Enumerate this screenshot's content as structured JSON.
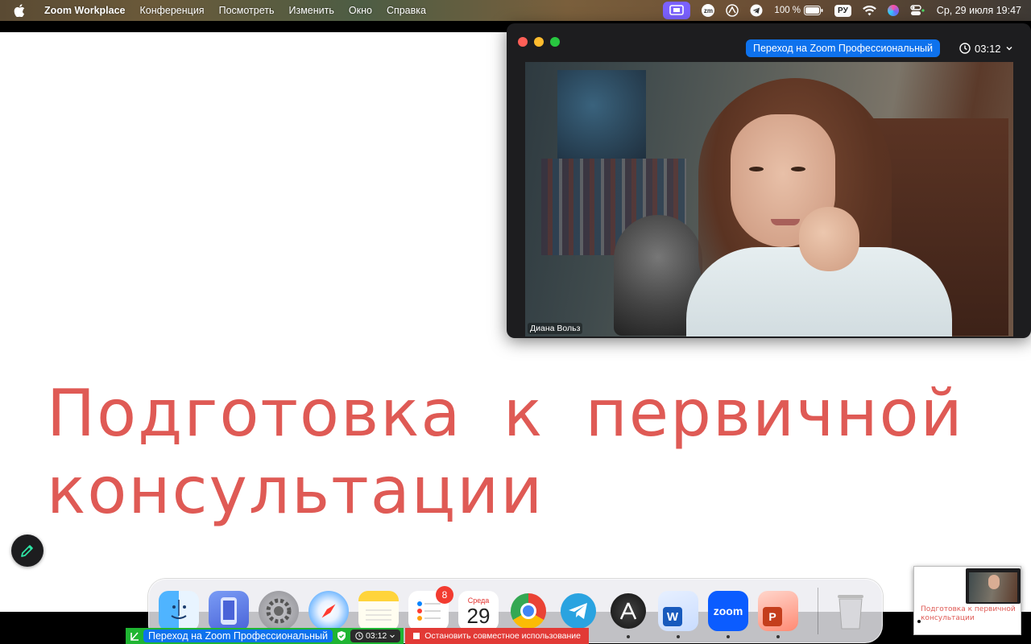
{
  "menubar": {
    "app_name": "Zoom Workplace",
    "menus": [
      "Конференция",
      "Посмотреть",
      "Изменить",
      "Окно",
      "Справка"
    ],
    "battery": "100 %",
    "input_language": "РУ",
    "datetime": "Ср, 29 июля  19:47",
    "zoom_tray_label": "zm"
  },
  "slide": {
    "title_line1": "Подготовка к  первичной",
    "title_line2": "консультации",
    "title_color": "#df5a55"
  },
  "zoom_window": {
    "upgrade_label": "Переход на Zoom Профессиональный",
    "timer": "03:12",
    "participant_name": "Диана Вольз",
    "accent": "#0e72ed"
  },
  "dock": {
    "calendar_weekday": "Среда",
    "calendar_day": "29",
    "reminders_badge": "8",
    "zoom_label": "zoom",
    "apps": [
      "finder-icon",
      "simulator-icon",
      "system-settings-icon",
      "safari-icon",
      "notes-icon",
      "reminders-icon",
      "calendar-icon",
      "chrome-icon",
      "telegram-icon",
      "instruments-icon",
      "word-icon",
      "zoom-icon",
      "powerpoint-icon",
      "trash-icon"
    ]
  },
  "share_bar": {
    "upgrade_label": "Переход на Zoom Профессиональный",
    "timer": "03:12",
    "stop_label": "Остановить совместное использование",
    "stop_color": "#e23a36",
    "bar_color": "#1fb532"
  },
  "thumbnail": {
    "title": "Подготовка к  первичной консультации"
  }
}
